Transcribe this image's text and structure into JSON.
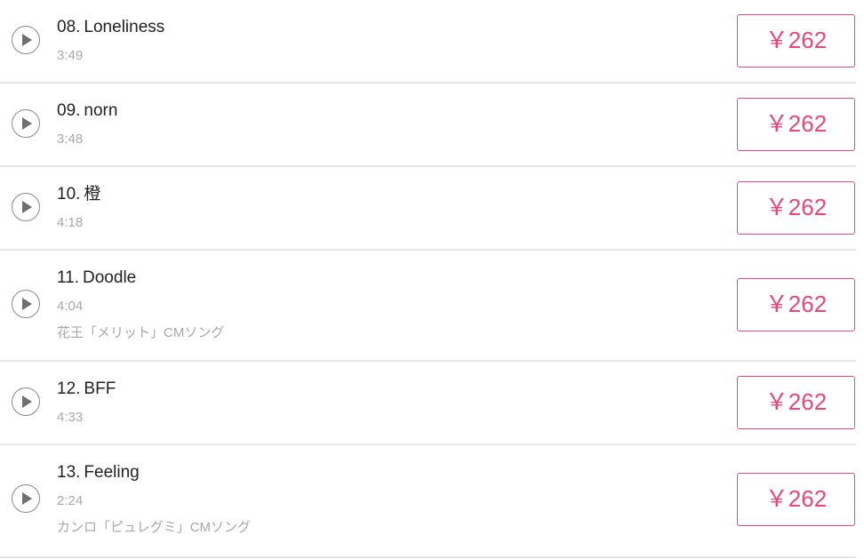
{
  "accent_color": "#e8487a",
  "tracks": [
    {
      "number": "08.",
      "title": "Loneliness",
      "duration": "3:49",
      "note": "",
      "price": "￥262",
      "play_icon": "play-icon"
    },
    {
      "number": "09.",
      "title": "norn",
      "duration": "3:48",
      "note": "",
      "price": "￥262",
      "play_icon": "play-icon"
    },
    {
      "number": "10.",
      "title": "橙",
      "duration": "4:18",
      "note": "",
      "price": "￥262",
      "play_icon": "play-icon"
    },
    {
      "number": "11.",
      "title": "Doodle",
      "duration": "4:04",
      "note": "花王「メリット」CMソング",
      "price": "￥262",
      "play_icon": "play-icon"
    },
    {
      "number": "12.",
      "title": "BFF",
      "duration": "4:33",
      "note": "",
      "price": "￥262",
      "play_icon": "play-icon"
    },
    {
      "number": "13.",
      "title": "Feeling",
      "duration": "2:24",
      "note": "カンロ「ピュレグミ」CMソング",
      "price": "￥262",
      "play_icon": "play-icon"
    }
  ]
}
